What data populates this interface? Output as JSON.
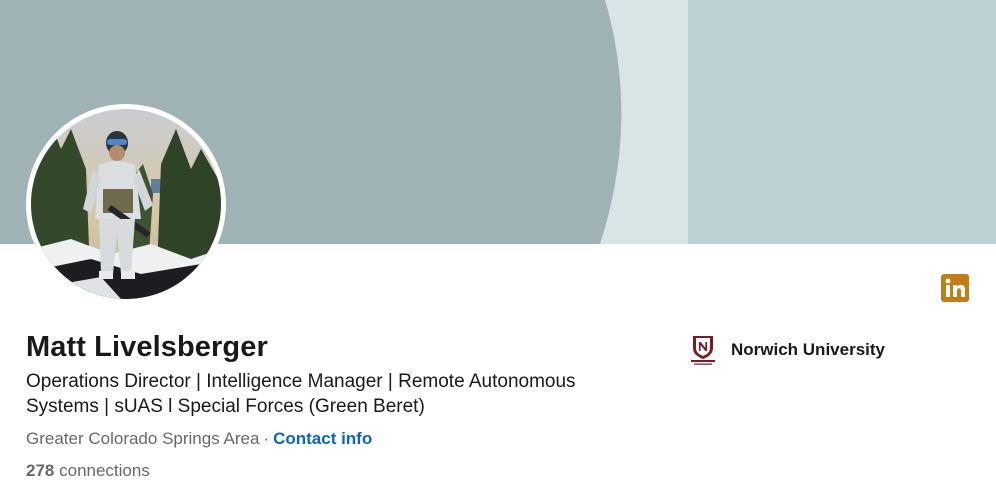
{
  "profile": {
    "name": "Matt Livelsberger",
    "headline": "Operations Director | Intelligence Manager | Remote Autonomous Systems | sUAS l Special Forces (Green Beret)",
    "location": "Greater Colorado Springs Area",
    "location_separator": "·",
    "contact_label": "Contact info",
    "connections_count": "278",
    "connections_label": "connections"
  },
  "education": {
    "school_name": "Norwich University"
  },
  "colors": {
    "banner_dark": "#9fb2b6",
    "banner_light": "#d9e4e7",
    "banner_right": "#bed2d6",
    "linkedin_badge": "#c37d16",
    "link_blue": "#0a66c2",
    "school_maroon": "#7a1a22"
  },
  "icons": {
    "badge": "linkedin-icon",
    "school": "norwich-university-logo"
  }
}
